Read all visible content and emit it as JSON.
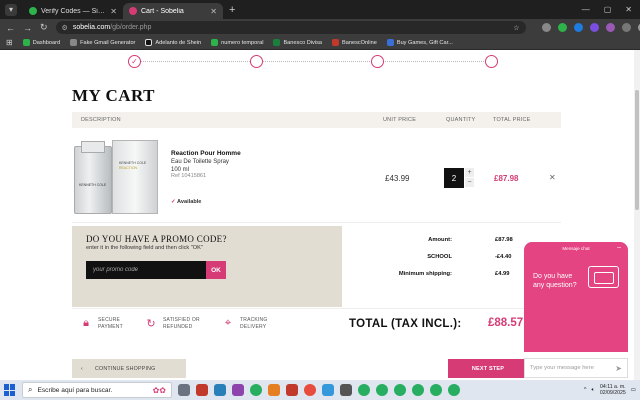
{
  "browser": {
    "tabs": [
      {
        "title": "Verify Codes — SimplyCodes",
        "favicon_color": "#2db34a",
        "active": false
      },
      {
        "title": "Cart - Sobelia",
        "favicon_color": "#d63b75",
        "active": true
      }
    ],
    "url_host": "sobelia.com",
    "url_path": "/gb/order.php",
    "bookmarks": [
      {
        "label": "Dashboard",
        "color": "#2db34a"
      },
      {
        "label": "Fake Gmail Generator",
        "color": "#888888"
      },
      {
        "label": "Adelanto de Shein",
        "color": "#111111"
      },
      {
        "label": "numero temporal",
        "color": "#2db34a"
      },
      {
        "label": "Banesco Divisa",
        "color": "#1a7f3c"
      },
      {
        "label": "BanescOnline",
        "color": "#c0392b"
      },
      {
        "label": "Buy Games, Gift Car...",
        "color": "#3b6fd8"
      }
    ]
  },
  "cart": {
    "title": "MY CART",
    "headers": {
      "description": "DESCRIPTION",
      "unit_price": "UNIT PRICE",
      "quantity": "QUANTITY",
      "total_price": "TOTAL PRICE"
    },
    "item": {
      "name": "Reaction Pour Homme",
      "type": "Eau De Toilette Spray",
      "size": "100 ml",
      "ref": "Ref 10415861",
      "availability": "Available",
      "unit_price": "£43.99",
      "quantity": "2",
      "total_price": "£87.98",
      "image_text": [
        "KENNETH COLE",
        "REACTION"
      ]
    },
    "promo": {
      "title": "DO YOU HAVE A PROMO CODE?",
      "subtitle": "enter it in the following field and then click \"OK\"",
      "placeholder": "your promo code",
      "ok_label": "OK"
    },
    "summary": [
      {
        "label": "Amount:",
        "value": "£87.98",
        "removable": false
      },
      {
        "label": "SCHOOL",
        "value": "-£4.40",
        "removable": true
      },
      {
        "label": "Minimum shipping:",
        "value": "£4.99",
        "removable": false
      }
    ],
    "features": [
      {
        "icon": "lock-icon",
        "label": "SECURE PAYMENT"
      },
      {
        "icon": "refresh-icon",
        "label": "SATISFIED OR REFUNDED"
      },
      {
        "icon": "location-pin-icon",
        "label": "TRACKING DELIVERY"
      }
    ],
    "total_label": "TOTAL (TAX INCL.):",
    "total_value": "£88.57",
    "continue_label": "CONTINUE SHOPPING",
    "next_label": "NEXT STEP"
  },
  "chat": {
    "header_label": "Mensaje chat",
    "question": "Do you have any question?",
    "input_placeholder": "Type your message here"
  },
  "taskbar": {
    "search_placeholder": "Escribe aquí para buscar.",
    "time": "04:11 a. m.",
    "date": "02/09/2025"
  },
  "colors": {
    "accent": "#d63b75",
    "chat": "#e44482",
    "panel": "#e2ddd3"
  }
}
